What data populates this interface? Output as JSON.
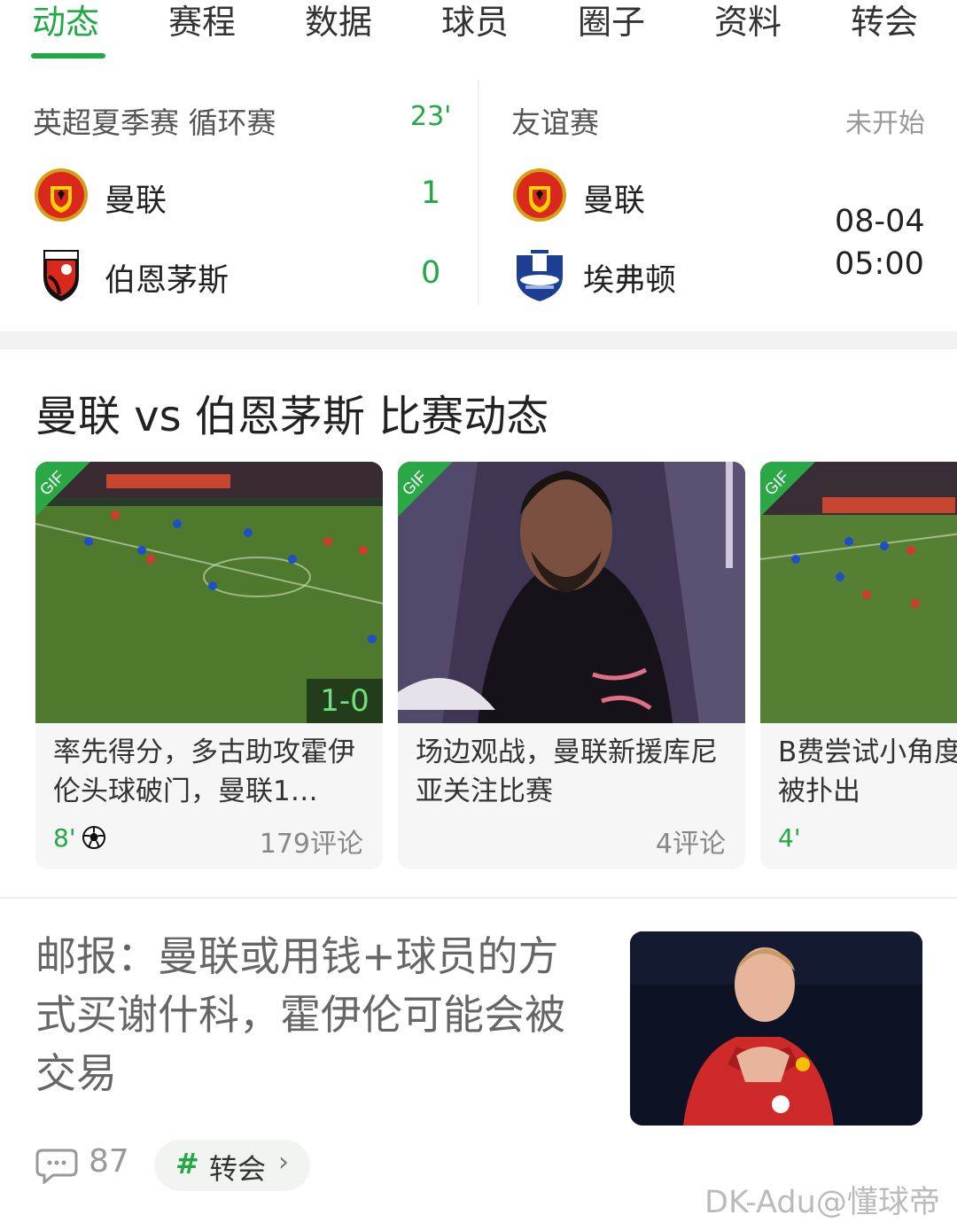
{
  "tabs": [
    "动态",
    "赛程",
    "数据",
    "球员",
    "圈子",
    "资料",
    "转会"
  ],
  "active_tab": "动态",
  "matches": [
    {
      "competition": "英超夏季赛 循环赛",
      "minute": "23'",
      "home": {
        "name": "曼联",
        "score": "1",
        "logo": "man-utd-crest"
      },
      "away": {
        "name": "伯恩茅斯",
        "score": "0",
        "logo": "bournemouth-crest"
      }
    },
    {
      "competition": "友谊赛",
      "status": "未开始",
      "home": {
        "name": "曼联",
        "logo": "man-utd-crest"
      },
      "away": {
        "name": "埃弗顿",
        "logo": "everton-crest"
      },
      "date": "08-04",
      "time": "05:00"
    }
  ],
  "section_title": "曼联 vs 伯恩茅斯 比赛动态",
  "cards": [
    {
      "badge": "GIF",
      "score_overlay": "1-0",
      "title": "率先得分，多古助攻霍伊伦头球破门，曼联1…",
      "minute": "8'",
      "icon": "football-icon",
      "comments": "179评论"
    },
    {
      "badge": "GIF",
      "title": "场边观战，曼联新援库尼亚关注比赛",
      "comments": "4评论"
    },
    {
      "badge": "GIF",
      "title": "B费尝试小角度球被扑出",
      "minute": "4'"
    }
  ],
  "news": {
    "title": "邮报：曼联或用钱+球员的方式买谢什科，霍伊伦可能会被交易",
    "comments": "87",
    "tag_symbol": "#",
    "tag": "转会",
    "tag_chevron": "›"
  },
  "watermark": "DK-Adu@懂球帝",
  "colors": {
    "accent": "#22a845",
    "muted": "#999999",
    "gap": "#f2f2f2"
  }
}
